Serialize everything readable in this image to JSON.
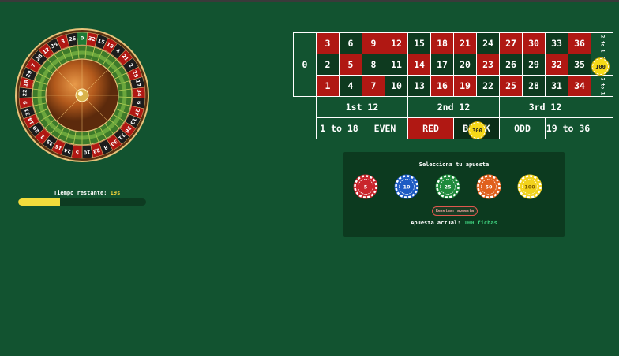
{
  "timer": {
    "label": "Tiempo restante:",
    "value": "19s",
    "fraction": 0.33
  },
  "wheel": {
    "numbers": [
      "0",
      "32",
      "15",
      "19",
      "4",
      "21",
      "2",
      "25",
      "17",
      "34",
      "6",
      "27",
      "13",
      "36",
      "11",
      "30",
      "8",
      "23",
      "10",
      "5",
      "24",
      "16",
      "33",
      "1",
      "20",
      "14",
      "31",
      "9",
      "22",
      "18",
      "29",
      "7",
      "28",
      "12",
      "35",
      "3",
      "26"
    ],
    "colors": {
      "red": "#b01813",
      "black": "#1c1c1c",
      "green": "#1f7a36"
    }
  },
  "board": {
    "zero": "0",
    "rows": [
      [
        "3",
        "6",
        "9",
        "12",
        "15",
        "18",
        "21",
        "24",
        "27",
        "30",
        "33",
        "36"
      ],
      [
        "2",
        "5",
        "8",
        "11",
        "14",
        "17",
        "20",
        "23",
        "26",
        "29",
        "32",
        "35"
      ],
      [
        "1",
        "4",
        "7",
        "10",
        "13",
        "16",
        "19",
        "22",
        "25",
        "28",
        "31",
        "34"
      ]
    ],
    "red_numbers": [
      "1",
      "3",
      "5",
      "7",
      "9",
      "12",
      "14",
      "16",
      "18",
      "19",
      "21",
      "23",
      "25",
      "27",
      "30",
      "32",
      "34",
      "36"
    ],
    "column_bet": "2 to 1",
    "dozens": [
      "1st 12",
      "2nd 12",
      "3rd 12"
    ],
    "outside": [
      "1 to 18",
      "EVEN",
      "RED",
      "BLACK",
      "ODD",
      "19 to 36"
    ],
    "placed_chips": [
      {
        "bet": "column-2",
        "amount": "100"
      },
      {
        "bet": "RED",
        "amount": "300"
      }
    ]
  },
  "panel": {
    "title": "Selecciona tu apuesta",
    "chips": [
      {
        "value": "5",
        "color": "#c9252c"
      },
      {
        "value": "10",
        "color": "#1d5bc4"
      },
      {
        "value": "25",
        "color": "#1f8a3c"
      },
      {
        "value": "50",
        "color": "#e0601c"
      },
      {
        "value": "100",
        "color": "#f2d21c"
      }
    ],
    "reset_label": "Resetear apuesta",
    "current_label": "Apuesta actual:",
    "current_value": "100 fichas"
  }
}
